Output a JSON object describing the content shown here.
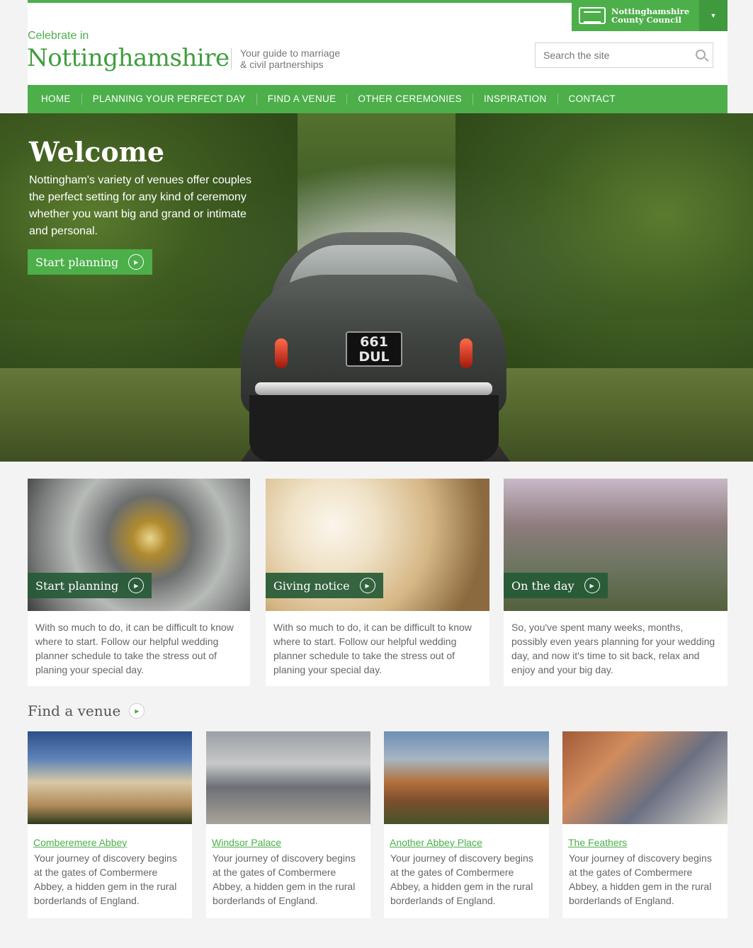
{
  "header": {
    "council_name_line1": "Nottinghamshire",
    "council_name_line2": "County Council",
    "brand_small": "Celebrate in",
    "brand_big": "Nottinghamshire",
    "tagline_line1": "Your guide to marriage",
    "tagline_line2": "& civil partnerships",
    "search_placeholder": "Search the site"
  },
  "nav": [
    "HOME",
    "PLANNING YOUR PERFECT DAY",
    "FIND A VENUE",
    "OTHER CEREMONIES",
    "INSPIRATION",
    "CONTACT"
  ],
  "hero": {
    "title": "Welcome",
    "body": "Nottingham's variety of venues offer couples the perfect setting for any kind of ceremony whether you want big and grand or intimate and personal.",
    "button": "Start planning",
    "plate_line1": "661",
    "plate_line2": "DUL"
  },
  "cards": [
    {
      "label": "Start planning",
      "text": "With so much to do, it can be difficult to know where to start. Follow our helpful wedding planner schedule to take the stress out of planing your special day."
    },
    {
      "label": "Giving notice",
      "text": "With so much to do, it can be difficult to know where to start. Follow our helpful wedding planner schedule to take the stress out of planing your special day."
    },
    {
      "label": "On the day",
      "text": "So, you've spent many weeks, months, possibly even years planning for your wedding day, and now it's time to sit back, relax and enjoy and your big day."
    }
  ],
  "venues_section": {
    "heading": "Find a venue",
    "items": [
      {
        "name": "Comberemere Abbey",
        "text": "Your journey of discovery begins at the gates of Combermere Abbey, a hidden gem in the rural borderlands of England."
      },
      {
        "name": "Windsor Palace",
        "text": "Your journey of discovery begins at the gates of Combermere Abbey, a hidden gem in the rural borderlands of England."
      },
      {
        "name": "Another Abbey Place",
        "text": "Your journey of discovery begins at the gates of Combermere Abbey, a hidden gem in the rural borderlands of England."
      },
      {
        "name": "The Feathers",
        "text": "Your journey of discovery begins at the gates of Combermere Abbey, a hidden gem in the rural borderlands of England."
      }
    ]
  },
  "colors": {
    "accent": "#4caf4a",
    "label_bg": "#265a36"
  }
}
